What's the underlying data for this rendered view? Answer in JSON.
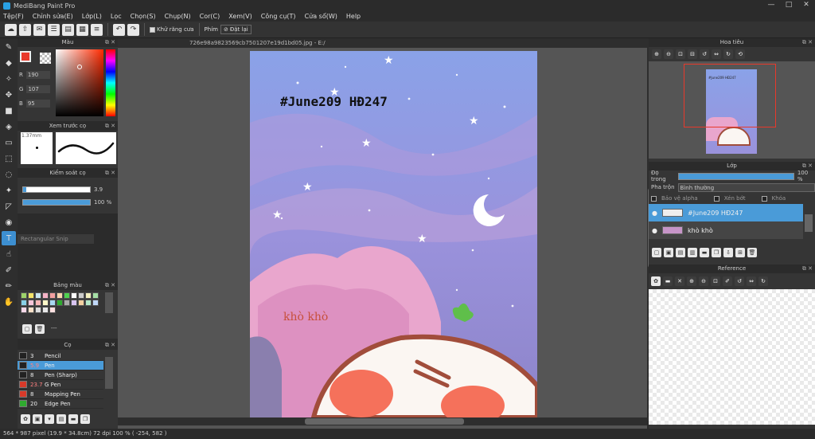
{
  "app": {
    "title": "MediBang Paint Pro"
  },
  "menu": [
    "Tệp(F)",
    "Chỉnh sửa(E)",
    "Lớp(L)",
    "Lọc",
    "Chọn(S)",
    "Chụp(N)",
    "Cor(C)",
    "Xem(V)",
    "Công cụ(T)",
    "Cửa sổ(W)",
    "Help"
  ],
  "toolbar": {
    "antialias_label": "Khử răng cưa",
    "keys_label": "Phím",
    "reset_label": "Đặt lại"
  },
  "color_panel": {
    "title": "Màu",
    "r": "190",
    "g": "107",
    "b": "95",
    "r_label": "R",
    "g_label": "G",
    "b_label": "B",
    "primary": "#e8392b"
  },
  "brush_preview": {
    "title": "Xem trước cọ",
    "size": "1.37mm"
  },
  "brush_control": {
    "title": "Kiểm soát cọ",
    "size_value": "3.9",
    "opacity_value": "100 %"
  },
  "tool_hint": "Rectangular Snip",
  "palette": {
    "title": "Bảng màu",
    "name": "---"
  },
  "brushes": {
    "title": "Cọ",
    "items": [
      {
        "size": "3",
        "name": "Pencil",
        "color": "#222222"
      },
      {
        "size": "5.9",
        "name": "Pen",
        "color": "#222222"
      },
      {
        "size": "8",
        "name": "Pen (Sharp)",
        "color": "#222222"
      },
      {
        "size": "23.7",
        "name": "G Pen",
        "color": "#d83a2a"
      },
      {
        "size": "8",
        "name": "Mapping Pen",
        "color": "#d83a2a"
      },
      {
        "size": "20",
        "name": "Edge Pen",
        "color": "#2faa2f"
      }
    ]
  },
  "document": {
    "filename": "726e98a9823569cb7501207e19d1bd05.jpg - E:/"
  },
  "artwork_text": {
    "title": "#June209 HĐ247",
    "caption": "khò khò"
  },
  "navigator": {
    "title": "Hoa tiêu",
    "thumb_text": "#June209 HĐ247"
  },
  "layers": {
    "title": "Lớp",
    "opacity_label": "Độ trong",
    "opacity_value": "100 %",
    "blend_label": "Pha trộn",
    "blend_value": "Bình thường",
    "protect_alpha": "Bảo vệ alpha",
    "clip": "Xén bớt",
    "lock": "Khóa",
    "items": [
      {
        "name": "#June209 HĐ247",
        "selected": true
      },
      {
        "name": "khò khò",
        "selected": false
      }
    ]
  },
  "reference": {
    "title": "Reference"
  },
  "status": {
    "text": "564 * 987 pixel   (19.9 * 34.8cm)   72 dpi   100 %   ( -254, 582 )"
  }
}
